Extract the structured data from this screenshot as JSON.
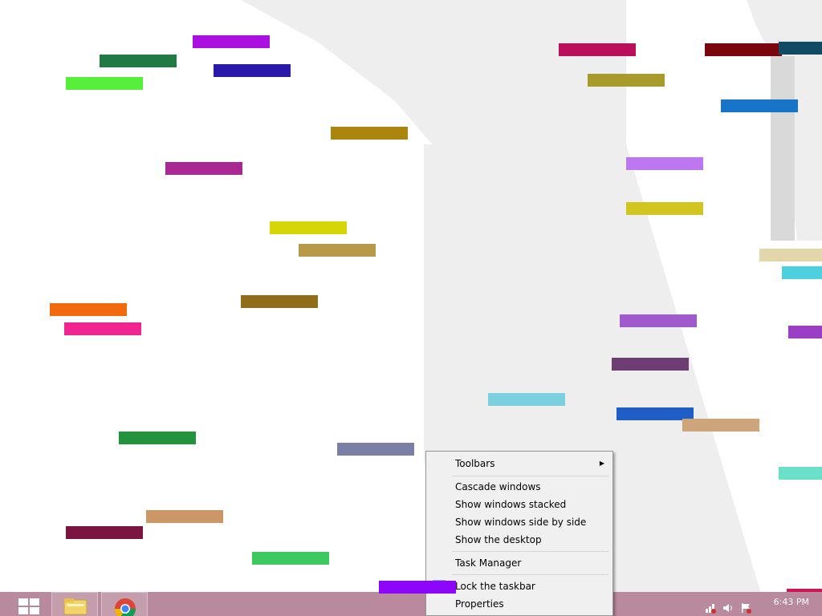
{
  "desktop": {
    "background_color": "#ffffff",
    "shape_color": "#eeeeee",
    "color_bars": [
      "#aa10e0",
      "#1f7a44",
      "#2a1aa8",
      "#58ef3c",
      "#ba0f5b",
      "#a79b2b",
      "#7b050d",
      "#104a63",
      "#1874c8",
      "#ac850c",
      "#aa2894",
      "#bc77f1",
      "#d2c522",
      "#d6d606",
      "#b8994a",
      "#e4d6ab",
      "#4dcfde",
      "#8f6d1a",
      "#f26a0c",
      "#f02590",
      "#9f5bcb",
      "#9b3dc5",
      "#6e3d74",
      "#7ccfdc",
      "#1f5fc5",
      "#cea47a",
      "#23923d",
      "#7a7fa3",
      "#6ae0c9",
      "#cc9667",
      "#7b1440",
      "#3ec860",
      "#d01553",
      "#8c06f9"
    ]
  },
  "taskbar": {
    "color": "#b9899d",
    "start_icon": "windows-logo-icon",
    "pinned": [
      {
        "name": "file-explorer",
        "icon": "folder-icon"
      },
      {
        "name": "chrome",
        "icon": "chrome-icon"
      }
    ],
    "tray_icons": [
      "network-icon",
      "volume-icon",
      "flag-icon"
    ],
    "clock": "6:43 PM",
    "date": ""
  },
  "context_menu": {
    "items": {
      "toolbars": "Toolbars",
      "cascade": "Cascade windows",
      "stacked": "Show windows stacked",
      "side_by_side": "Show windows side by side",
      "show_desktop": "Show the desktop",
      "task_manager": "Task Manager",
      "lock_taskbar": "Lock the taskbar",
      "properties": "Properties"
    },
    "lock_taskbar_checked": true,
    "submenu_arrow_icon": "triangle-right-icon"
  }
}
